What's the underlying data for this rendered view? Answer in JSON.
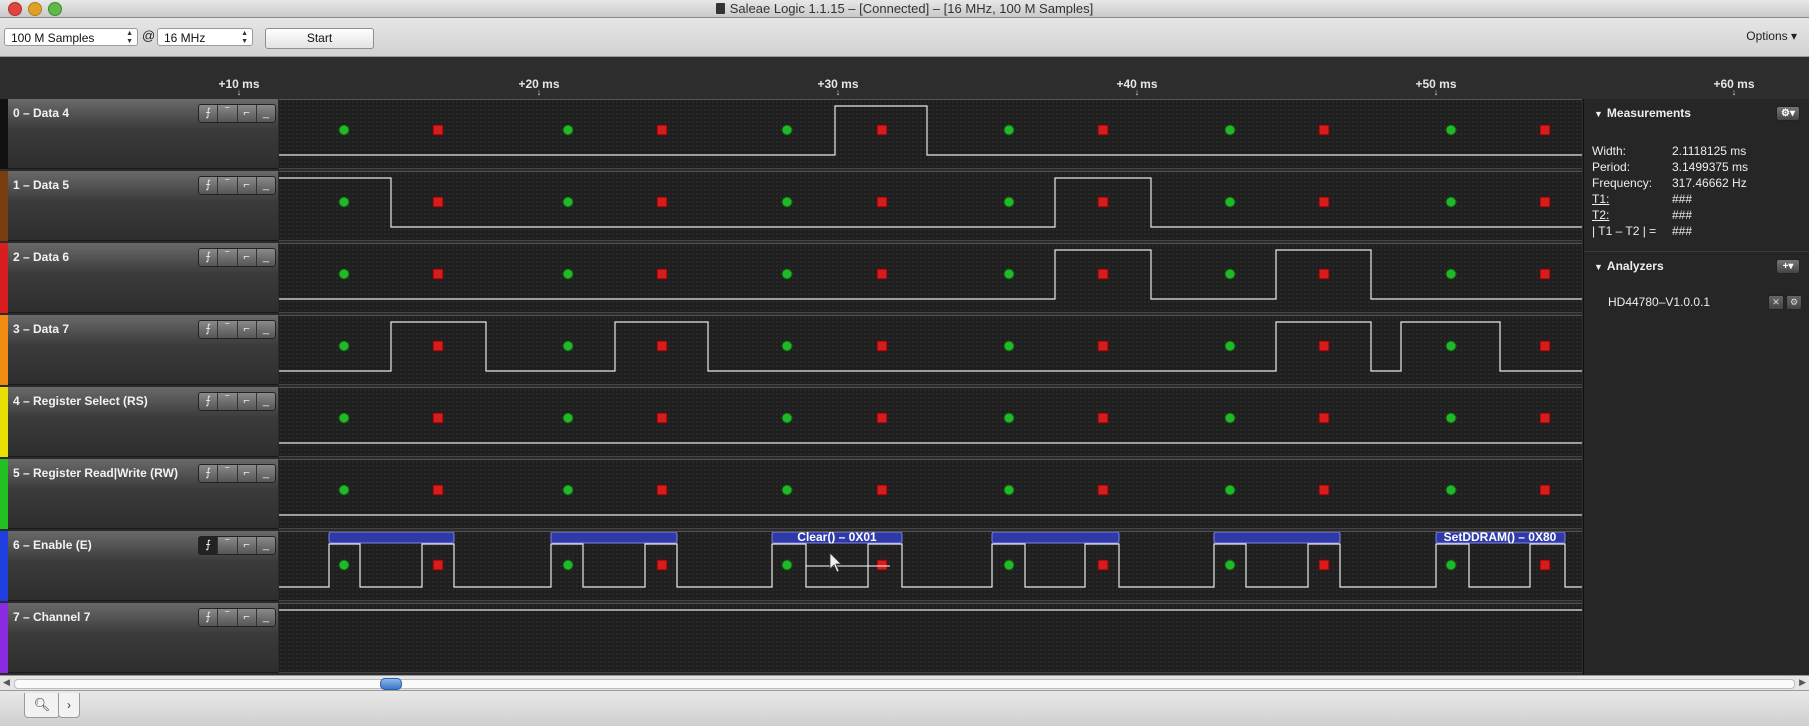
{
  "window": {
    "title": "Saleae Logic 1.1.15 – [Connected] – [16 MHz, 100 M Samples]"
  },
  "toolbar": {
    "samples_value": "100 M Samples",
    "at_label": "@",
    "rate_value": "16 MHz",
    "start_label": "Start",
    "options_label": "Options ▾"
  },
  "ruler": {
    "ticks": [
      "+10 ms",
      "+20 ms",
      "+30 ms",
      "+40 ms",
      "+50 ms",
      "+60 ms"
    ]
  },
  "channels": [
    {
      "name": "0 – Data 4",
      "color": "#111111"
    },
    {
      "name": "1 – Data 5",
      "color": "#7a3d10"
    },
    {
      "name": "2 – Data 6",
      "color": "#d81e1e"
    },
    {
      "name": "3 – Data 7",
      "color": "#f08a10"
    },
    {
      "name": "4 – Register Select (RS)",
      "color": "#e8e000"
    },
    {
      "name": "5 – Register Read|Write (RW)",
      "color": "#22c022"
    },
    {
      "name": "6 – Enable  (E)",
      "color": "#1e3ee0"
    },
    {
      "name": "7 – Channel 7",
      "color": "#8a2be2"
    }
  ],
  "trigger_glyphs": [
    "⨍",
    "‾",
    "⌐",
    "_"
  ],
  "decoded_labels": {
    "clear": "Clear() – 0X01",
    "setddram": "SetDDRAM() – 0X80"
  },
  "measurements": {
    "header": "Measurements",
    "width_label": "Width:",
    "width_value": "2.1118125 ms",
    "period_label": "Period:",
    "period_value": "3.1499375 ms",
    "frequency_label": "Frequency:",
    "frequency_value": "317.46662 Hz",
    "t1_label": "T1:",
    "t1_value": "###",
    "t2_label": "T2:",
    "t2_value": "###",
    "diff_label": "| T1 – T2 | =",
    "diff_value": "###"
  },
  "analyzers": {
    "header": "Analyzers",
    "items": [
      "HD44780–V1.0.0.1"
    ]
  },
  "colors": {
    "green_marker": "#23b82a",
    "red_marker": "#d91b1b",
    "trace": "#e8e8e8",
    "decode_bar": "#2f3aa8"
  }
}
